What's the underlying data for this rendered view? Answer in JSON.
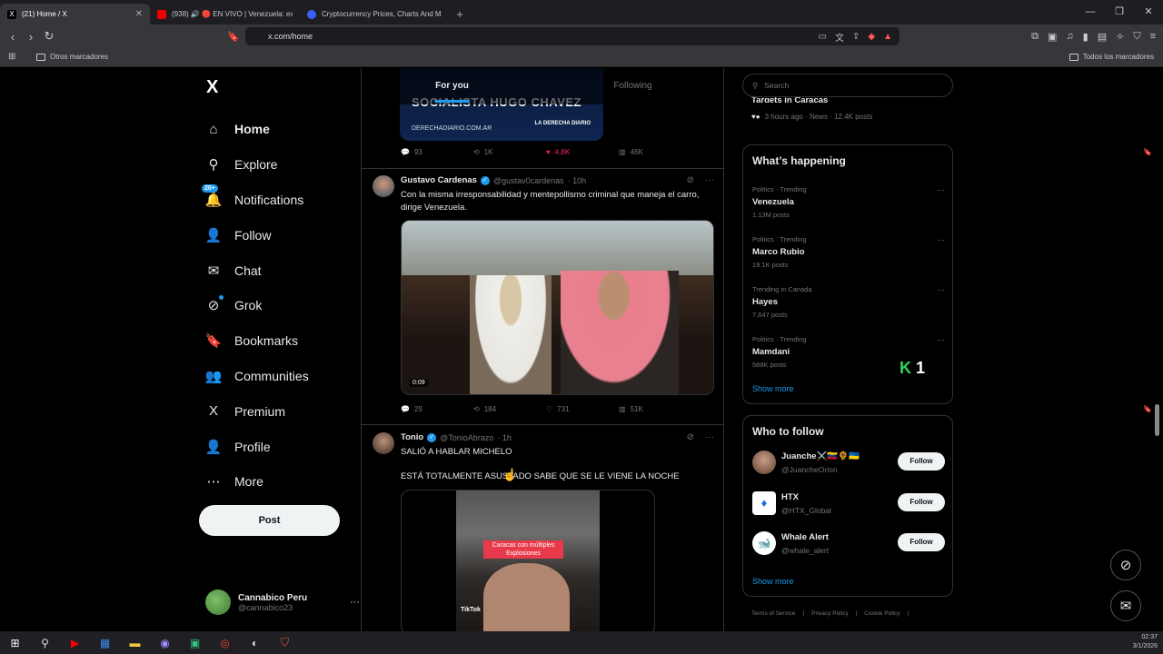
{
  "browser": {
    "tabs": [
      {
        "label": "(21) Home / X",
        "active": true
      },
      {
        "label": "(938) 🔊 🔴 EN VIVO | Venezuela: exp",
        "active": false
      },
      {
        "label": "Cryptocurrency Prices, Charts And M",
        "active": false
      }
    ],
    "url": "x.com/home",
    "bookmarks_left": "Otros marcadores",
    "bookmarks_right": "Todos los marcadores"
  },
  "sidebar": {
    "logo": "X",
    "items": [
      {
        "label": "Home",
        "icon": "home-icon",
        "glyph": "⌂"
      },
      {
        "label": "Explore",
        "icon": "search-icon",
        "glyph": "⚲"
      },
      {
        "label": "Notifications",
        "icon": "bell-icon",
        "glyph": "🔔",
        "badge": "20+"
      },
      {
        "label": "Follow",
        "icon": "person-add-icon",
        "glyph": "👤"
      },
      {
        "label": "Chat",
        "icon": "mail-icon",
        "glyph": "✉"
      },
      {
        "label": "Grok",
        "icon": "grok-icon",
        "glyph": "⊘"
      },
      {
        "label": "Bookmarks",
        "icon": "bookmark-icon",
        "glyph": "🔖"
      },
      {
        "label": "Communities",
        "icon": "communities-icon",
        "glyph": "👥"
      },
      {
        "label": "Premium",
        "icon": "x-logo-icon",
        "glyph": "X"
      },
      {
        "label": "Profile",
        "icon": "person-icon",
        "glyph": "👤"
      },
      {
        "label": "More",
        "icon": "more-circle-icon",
        "glyph": "⋯"
      }
    ],
    "post_button": "Post",
    "account": {
      "name": "Cannabico Peru",
      "handle": "@cannabico23"
    }
  },
  "feed": {
    "tabs": [
      "For you",
      "Following"
    ],
    "top_post": {
      "image_text_big": "SOCIALISTA HUGO CHAVEZ",
      "image_text_small": "DERECHADIARIO.COM.AR",
      "image_brand": "LA DERECHA DIARIO",
      "replies": "93",
      "reposts": "1K",
      "likes": "4.8K",
      "views": "46K"
    },
    "posts": [
      {
        "name": "Gustavo Cardenas",
        "handle": "@gustav0cardenas",
        "time": "· 10h",
        "text": "Con la misma irresponsabilidad y mentepollismo criminal que maneja el carro, dirige Venezuela.",
        "video_time": "0:09",
        "replies": "29",
        "reposts": "184",
        "likes": "731",
        "views": "51K"
      },
      {
        "name": "Tonio",
        "handle": "@TonioAbrazo",
        "time": "· 1h",
        "text_line1": "SALIÓ A HABLAR MICHELO",
        "text_line2": "ESTÁ TOTALMENTE ASUSTADO SABE QUE SE LE VIENE LA NOCHE",
        "video_label": "Caracas con múltiples Explosiones",
        "video_watermark": "TikTok"
      }
    ]
  },
  "right": {
    "search_placeholder": "Search",
    "partial_trend": {
      "meta": "3 hours ago · News · 12.4K posts",
      "title": "Targets in Caracas"
    },
    "whats_happening": {
      "title": "What’s happening",
      "trends": [
        {
          "meta": "Politics · Trending",
          "title": "Venezuela",
          "count": "1.13M posts"
        },
        {
          "meta": "Politics · Trending",
          "title": "Marco Rubio",
          "count": "19.1K posts"
        },
        {
          "meta": "Trending in Canada",
          "title": "Hayes",
          "count": "7,647 posts"
        },
        {
          "meta": "Politics · Trending",
          "title": "Mamdani",
          "count": "588K posts"
        }
      ],
      "show_more": "Show more"
    },
    "who_to_follow": {
      "title": "Who to follow",
      "accounts": [
        {
          "name": "Juanche⚔️🇻🇪🌻🇺🇦",
          "handle": "@JuancheOrion",
          "button": "Follow"
        },
        {
          "name": "HTX",
          "handle": "@HTX_Global",
          "button": "Follow"
        },
        {
          "name": "Whale Alert",
          "handle": "@whale_alert",
          "button": "Follow"
        }
      ],
      "show_more": "Show more"
    },
    "footer": [
      "Terms of Service",
      "|",
      "Privacy Policy",
      "|",
      "Cookie Policy",
      "|"
    ]
  },
  "overlay": {
    "k1_letter": "K",
    "k1_number": "1"
  },
  "taskbar": {
    "time": "02:37",
    "date": "3/1/2026"
  }
}
